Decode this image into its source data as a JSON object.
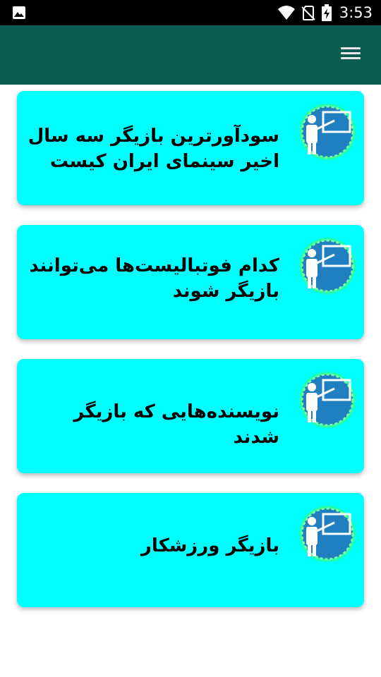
{
  "status_bar": {
    "time": "3:53",
    "icons": [
      "image-icon",
      "wifi-icon",
      "no-sim-icon",
      "battery-charging-icon"
    ]
  },
  "app_bar": {
    "menu_icon": "hamburger-menu-icon"
  },
  "items": [
    {
      "title": "سودآورترین بازیگر سه سال اخیر سینمای ایران کیست",
      "icon": "teacher-board-icon"
    },
    {
      "title": "کدام فوتبالیست‌ها می‌توانند بازیگر شوند",
      "icon": "teacher-board-icon"
    },
    {
      "title": "نویسنده‌هایی که بازیگر شدند",
      "icon": "teacher-board-icon"
    },
    {
      "title": "بازیگر  ورزشکار",
      "icon": "teacher-board-icon"
    }
  ],
  "colors": {
    "app_bar": "#0b5d51",
    "card": "#00ffff",
    "icon_badge": "#1f7fc0",
    "icon_glow": "#3cff6a"
  }
}
